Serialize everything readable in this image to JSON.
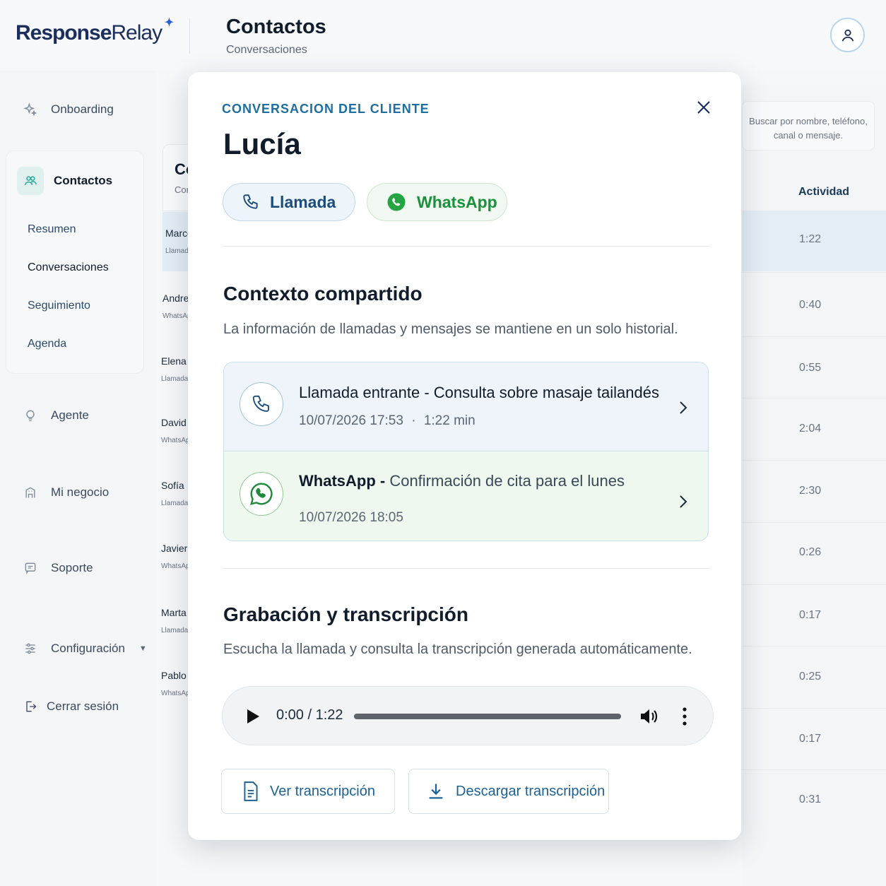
{
  "brand": {
    "name_part1": "Response",
    "name_part2": "Relay",
    "spark": "✦"
  },
  "header": {
    "title": "Contactos",
    "subtitle": "Conversaciones",
    "user_icon": "user-icon"
  },
  "sidebar": {
    "onboarding": "Onboarding",
    "contacts": "Contactos",
    "contacts_sub": [
      "Resumen",
      "Conversaciones",
      "Seguimiento",
      "Agenda"
    ],
    "agent": "Agente",
    "business": "Mi negocio",
    "support": "Soporte",
    "settings": "Configuración",
    "logout": "Cerrar sesión"
  },
  "list": {
    "card_title": "Co",
    "card_sub": "Cor",
    "search_placeholder_line1": "Buscar por nombre, teléfono,",
    "search_placeholder_line2": "canal o mensaje.",
    "activity_header": "Actividad",
    "rows": [
      {
        "name": "Marco",
        "channel": "Llamada",
        "activity": "1:22"
      },
      {
        "name": "Andrea",
        "channel": "WhatsApp",
        "activity": "0:40"
      },
      {
        "name": "Elena",
        "channel": "Llamada e",
        "activity": "0:55"
      },
      {
        "name": "David",
        "channel": "WhatsApp",
        "activity": "2:04"
      },
      {
        "name": "Sofía",
        "channel": "Llamada e",
        "activity": "2:30"
      },
      {
        "name": "Javier",
        "channel": "WhatsApp",
        "activity": "0:26"
      },
      {
        "name": "Marta",
        "channel": "Llamada e",
        "activity": "0:17"
      },
      {
        "name": "Pablo",
        "channel": "WhatsApp",
        "activity": "0:25"
      },
      {
        "name": "",
        "channel": "",
        "activity": "0:17"
      },
      {
        "name": "",
        "channel": "",
        "activity": "0:31"
      }
    ]
  },
  "modal": {
    "eyebrow": "CONVERSACION DEL CLIENTE",
    "name": "Lucía",
    "chip_call": "Llamada",
    "chip_whatsapp": "WhatsApp",
    "context_title": "Contexto compartido",
    "context_desc": "La información de llamadas y mensajes se mantiene en un solo historial.",
    "call_item": {
      "title": "Llamada entrante - Consulta sobre masaje tailandés",
      "date": "10/07/2026 17:53",
      "sep": "·",
      "duration": "1:22 min"
    },
    "wa_item": {
      "title_name": "WhatsApp",
      "title_sep": " - ",
      "title_rest": "Confirmación de cita para el lunes",
      "date": "10/07/2026 18:05"
    },
    "recording_title": "Grabación y transcripción",
    "recording_desc": "Escucha la llamada y consulta la transcripción generada automáticamente.",
    "player_time": "0:00 / 1:22",
    "player_progress": 0,
    "btn_view": "Ver transcripción",
    "btn_download": "Descargar transcripción"
  },
  "colors": {
    "accent": "#1e6ea0",
    "whatsapp": "#25a444",
    "brand": "#1b2e5c"
  }
}
